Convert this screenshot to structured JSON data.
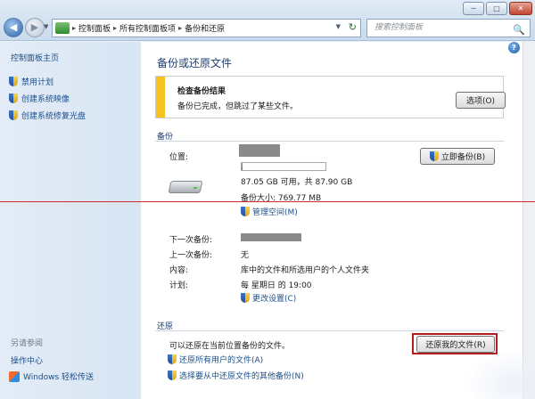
{
  "window": {
    "minimize": "─",
    "maximize": "□",
    "close": "✕"
  },
  "nav": {
    "back": "◀",
    "forward": "▶",
    "dropdown": "▼"
  },
  "address": {
    "breadcrumb": [
      "控制面板",
      "所有控制面板项",
      "备份和还原"
    ],
    "separator": "▸",
    "refresh": "↻",
    "dropdown": "▼"
  },
  "search": {
    "placeholder": "搜索控制面板",
    "icon": "🔍"
  },
  "sidebar": {
    "home": "控制面板主页",
    "tasks": [
      "禁用计划",
      "创建系统映像",
      "创建系统修复光盘"
    ],
    "see_also_title": "另请参阅",
    "see_also": [
      "操作中心",
      "Windows 轻松传送"
    ]
  },
  "main": {
    "help": "?",
    "title": "备份或还原文件",
    "notice": {
      "title": "检查备份结果",
      "message": "备份已完成，但跳过了某些文件。",
      "button": "选项(O)",
      "accent_color": "#f6c21e"
    },
    "backup": {
      "section": "备份",
      "location_label": "位置:",
      "space_text": "87.05 GB 可用，共 87.90 GB",
      "used_fraction": 0.01,
      "backup_size": "备份大小: 769.77 MB",
      "manage_space": "管理空间(M)",
      "backup_now": "立即备份(B)",
      "next_backup_label": "下一次备份:",
      "last_backup_label": "上一次备份:",
      "last_backup_value": "无",
      "contents_label": "内容:",
      "contents_value": "库中的文件和所选用户的个人文件夹",
      "schedule_label": "计划:",
      "schedule_value": "每 星期日 的 19:00",
      "change_settings": "更改设置(C)"
    },
    "restore": {
      "section": "还原",
      "description": "可以还原在当前位置备份的文件。",
      "restore_my_files": "还原我的文件(R)",
      "restore_all_users": "还原所有用户的文件(A)",
      "select_other": "选择要从中还原文件的其他备份(N)",
      "highlight_color": "#b31d1d"
    }
  }
}
